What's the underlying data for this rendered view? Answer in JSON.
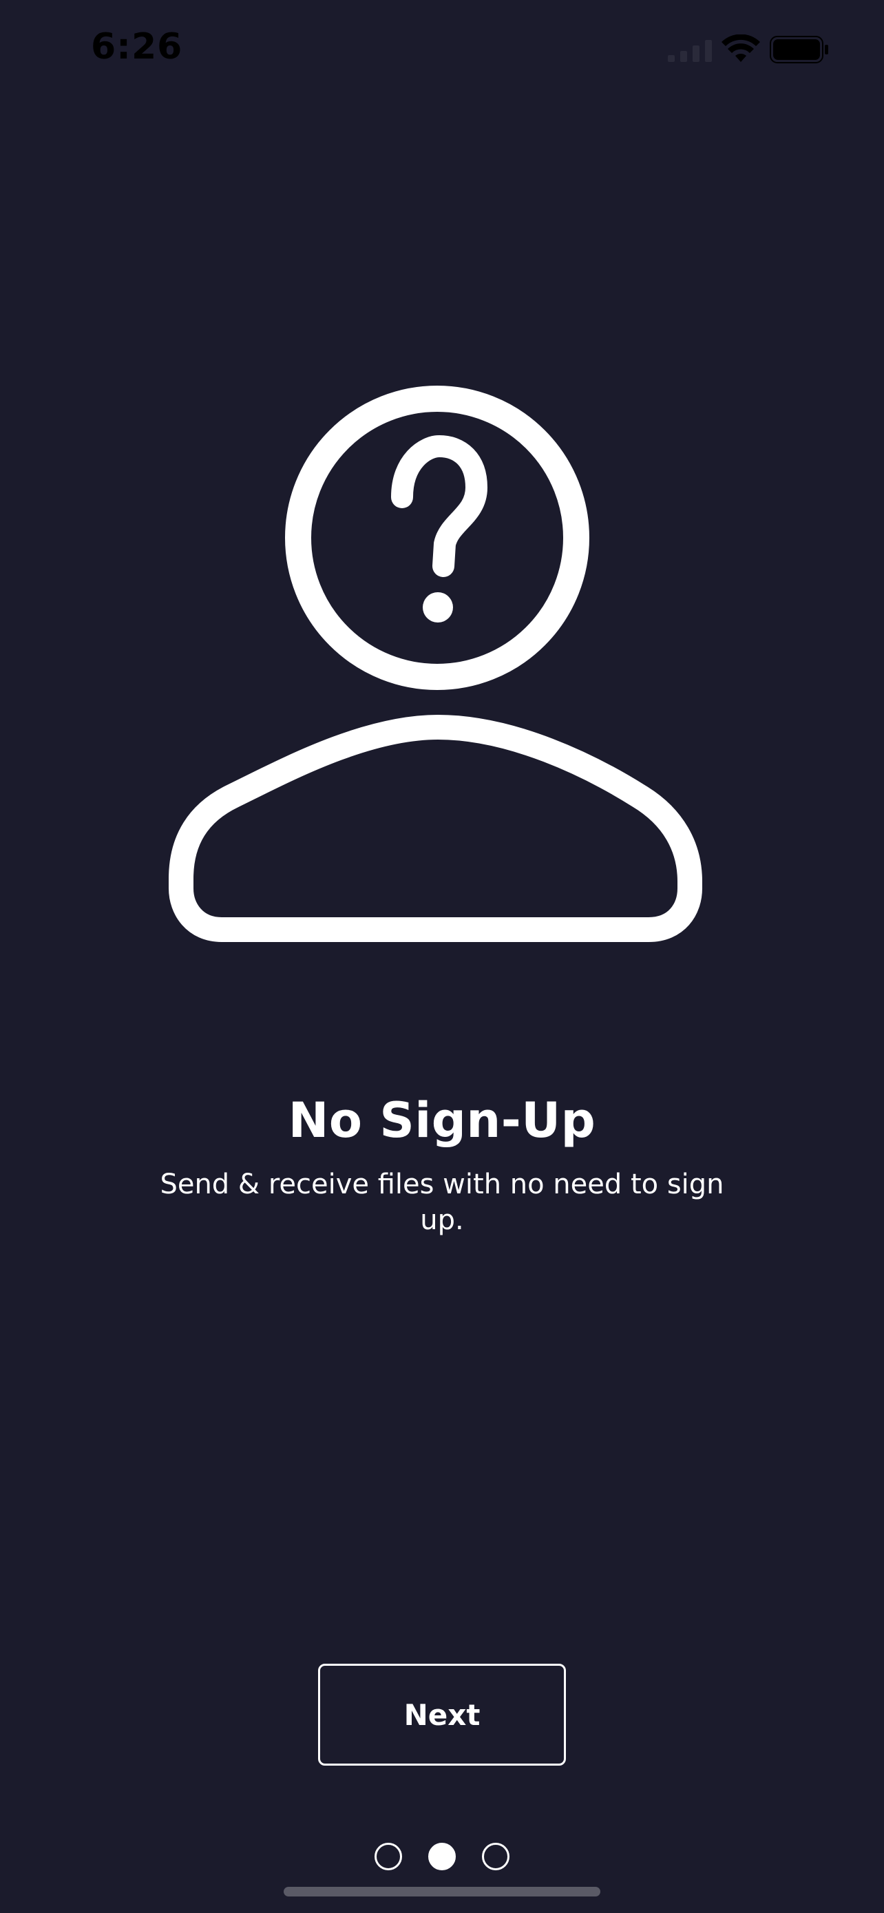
{
  "status_bar": {
    "time": "6:26",
    "icons": [
      "signal-icon",
      "wifi-icon",
      "battery-icon"
    ]
  },
  "onboarding": {
    "illustration_icon": "user-question-icon",
    "title": "No Sign-Up",
    "subtitle": "Send & receive files with no need to sign up."
  },
  "actions": {
    "next_label": "Next"
  },
  "pagination": {
    "total_pages": 3,
    "current_page": 2
  },
  "colors": {
    "background": "#1b1b2c",
    "foreground": "#ffffff"
  }
}
